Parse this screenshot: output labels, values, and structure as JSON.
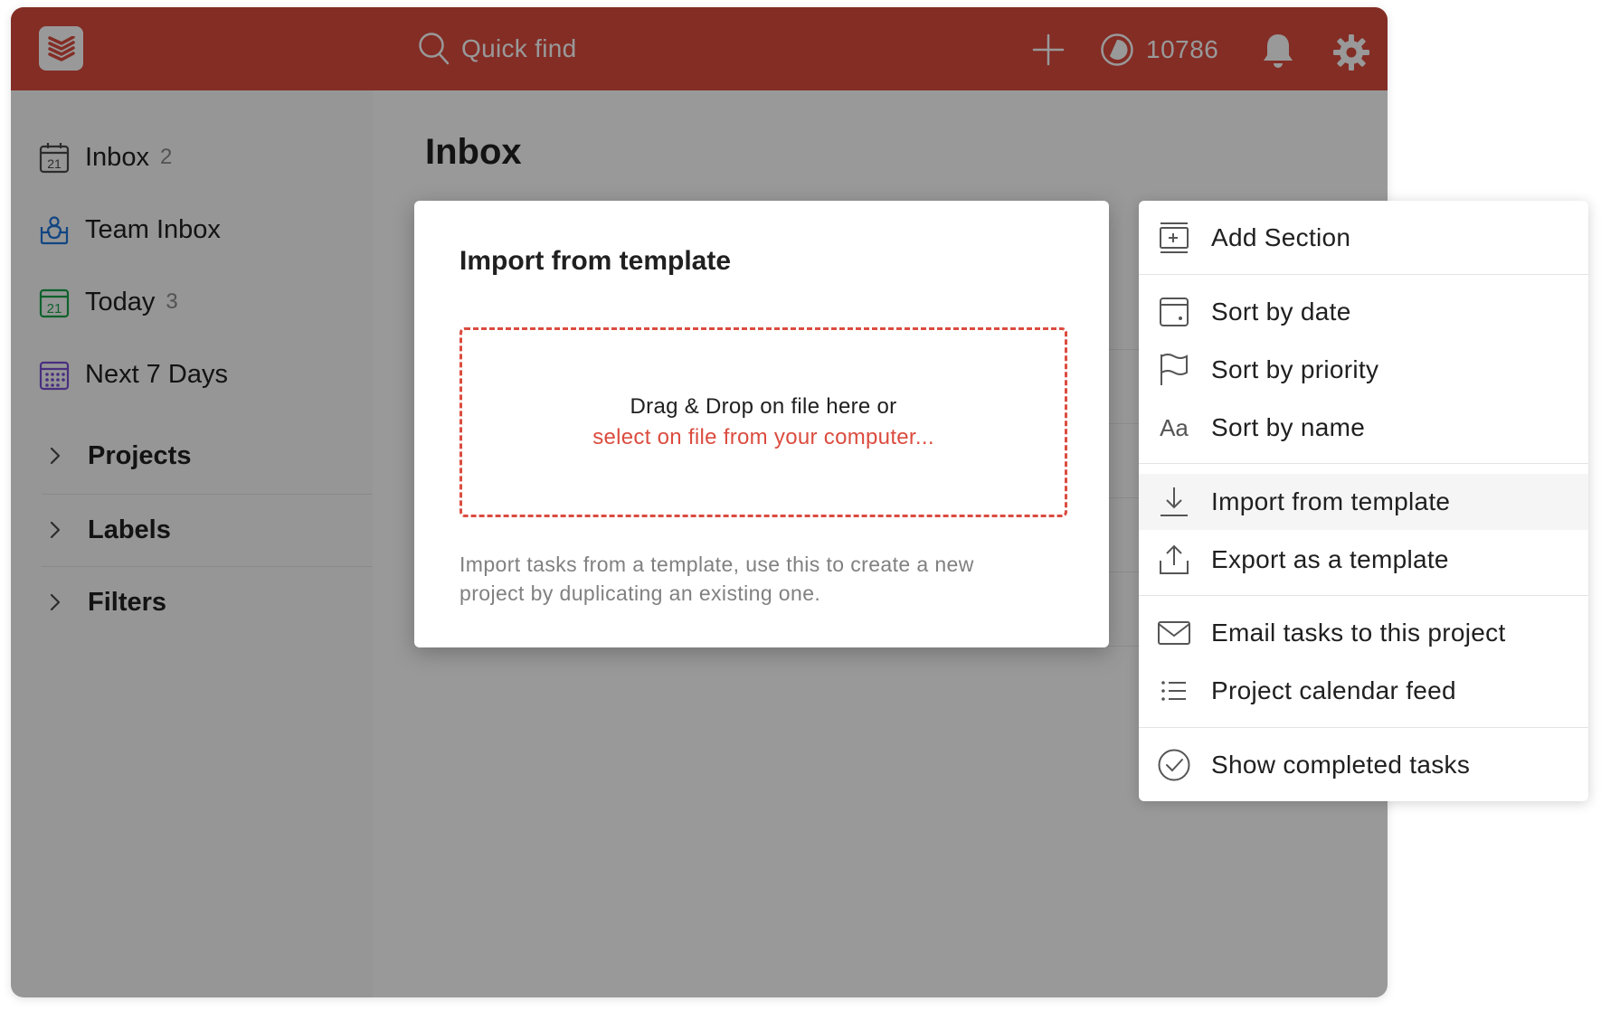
{
  "app": {
    "brand_color": "#db4c3f"
  },
  "topbar": {
    "search_placeholder": "Quick find",
    "karma_count": "10786"
  },
  "sidebar": {
    "nav": [
      {
        "label": "Inbox",
        "count": "2",
        "icon": "calendar-21-icon"
      },
      {
        "label": "Team Inbox",
        "count": "",
        "icon": "team-inbox-icon"
      },
      {
        "label": "Today",
        "count": "3",
        "icon": "calendar-today-icon"
      },
      {
        "label": "Next 7 Days",
        "count": "",
        "icon": "calendar-grid-icon"
      }
    ],
    "groups": [
      {
        "label": "Projects"
      },
      {
        "label": "Labels"
      },
      {
        "label": "Filters"
      }
    ]
  },
  "main": {
    "title": "Inbox"
  },
  "modal": {
    "title": "Import from template",
    "drop_text": "Drag & Drop on file here or",
    "drop_link": "select on file from your computer...",
    "description": "Import tasks from a template, use this to create a new project by duplicating an existing one."
  },
  "menu": {
    "items": [
      {
        "label": "Add Section",
        "icon": "add-section-icon"
      },
      {
        "label": "Sort by date",
        "icon": "calendar-icon"
      },
      {
        "label": "Sort by priority",
        "icon": "flag-icon"
      },
      {
        "label": "Sort by name",
        "icon": "text-aa-icon",
        "glyph": "Aa"
      },
      {
        "label": "Import from template",
        "icon": "download-icon",
        "active": true
      },
      {
        "label": "Export as a template",
        "icon": "upload-icon"
      },
      {
        "label": "Email tasks to this project",
        "icon": "envelope-icon"
      },
      {
        "label": "Project calendar feed",
        "icon": "list-icon"
      },
      {
        "label": "Show completed tasks",
        "icon": "check-circle-icon"
      }
    ]
  }
}
